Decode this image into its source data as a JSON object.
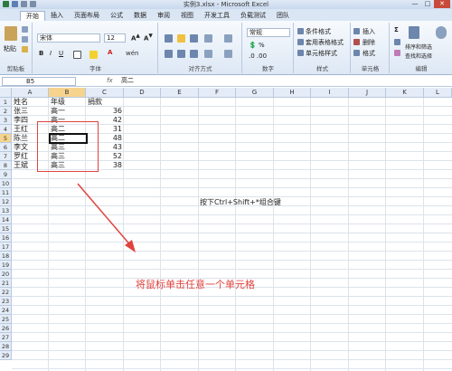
{
  "window": {
    "title": "实例3.xlsx - Microsoft Excel"
  },
  "tabs": [
    "开始",
    "插入",
    "页面布局",
    "公式",
    "数据",
    "审阅",
    "视图",
    "开发工具",
    "负载测试",
    "团队"
  ],
  "ribbon": {
    "clipboard": {
      "paste": "粘贴",
      "label": "剪贴板"
    },
    "font": {
      "name": "宋体",
      "size": "12",
      "label": "字体"
    },
    "alignment": {
      "label": "对齐方式"
    },
    "number": {
      "format": "常规",
      "label": "数字"
    },
    "styles": {
      "conditional": "条件格式",
      "table": "套用表格格式",
      "cell": "单元格样式",
      "label": "样式"
    },
    "cells": {
      "insert": "插入",
      "delete": "删除",
      "format": "格式",
      "label": "单元格"
    },
    "editing": {
      "sort": "排序和筛选",
      "find": "查找和选择",
      "label": "编辑"
    }
  },
  "formula_bar": {
    "name_box": "B5",
    "fx": "fx",
    "value": "高二"
  },
  "columns": [
    "A",
    "B",
    "C",
    "D",
    "E",
    "F",
    "G",
    "H",
    "I",
    "J",
    "K",
    "L"
  ],
  "rows": [
    "1",
    "2",
    "3",
    "4",
    "5",
    "6",
    "7",
    "8",
    "9",
    "10",
    "11",
    "12",
    "13",
    "14",
    "15",
    "16",
    "17",
    "18",
    "19",
    "20",
    "21",
    "22",
    "23",
    "24",
    "25",
    "26",
    "27",
    "28",
    "29"
  ],
  "table": [
    [
      "姓名",
      "年级",
      "捐款"
    ],
    [
      "张三",
      "高一",
      "36"
    ],
    [
      "李四",
      "高一",
      "42"
    ],
    [
      "王红",
      "高二",
      "31"
    ],
    [
      "陈兰",
      "高二",
      "48"
    ],
    [
      "李文",
      "高三",
      "43"
    ],
    [
      "罗红",
      "高三",
      "52"
    ],
    [
      "王斌",
      "高三",
      "38"
    ]
  ],
  "annotations": {
    "shortcut": "按下Ctrl+Shift+*组合键",
    "instruction": "将鼠标单击任意一个单元格"
  },
  "colors": {
    "accent": "#e0433d",
    "header": "#e4ecf7",
    "selected_header": "#f6d48e"
  }
}
